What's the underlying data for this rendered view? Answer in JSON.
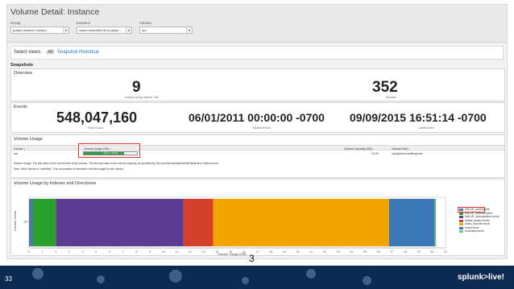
{
  "header": {
    "title": "Volume Detail: Instance",
    "group_label": "Group",
    "group_value": "potato (Indexer Cluster)",
    "instance_label": "Instance",
    "instance_value": "ssdev-centos65-06.sv.splun...",
    "volume_label": "Volume",
    "volume_value": "opt"
  },
  "views": {
    "label": "Select views:",
    "options": [
      "All",
      "Snapshot",
      "Historical"
    ]
  },
  "snapshots_heading": "Snapshots",
  "overview": {
    "title": "Overview",
    "indexes_value": "9",
    "indexes_caption": "Indexes using Volume \"opt\"",
    "buckets_value": "352",
    "buckets_caption": "Buckets"
  },
  "events": {
    "title": "Events",
    "count": "548,047,160",
    "count_caption": "Event Count",
    "earliest": "06/01/2011 00:00:00 -0700",
    "earliest_caption": "Earliest Event",
    "latest": "09/09/2015 16:51:14 -0700",
    "latest_caption": "Latest Event"
  },
  "volume_usage": {
    "title": "Volume Usage",
    "columns": [
      "Volume ↕",
      "Volume Usage (GB) ↕",
      "Volume Capacity (GB) ↕",
      "Volume Path ↕"
    ],
    "row": {
      "volume": "opt",
      "usage_text": "30.21 / 40.00",
      "usage_fraction": 0.755,
      "capacity": "40.00",
      "path": "/opt/splunk/var/lib/splunk"
    },
    "note1": "Volume Usage: The first value is the current size of the volume. The second value is the volume capacity, as specified by the maxVolumeDataSizeMB attribute in indexes.conf.",
    "note2": "Note: If the volume is \"unlimited\", it is not possible to determine the disk usage for the volume."
  },
  "usage_by_index": {
    "title": "Volume Usage by Indexes and Directories"
  },
  "chart_data": {
    "type": "bar",
    "orientation": "horizontal-stacked",
    "title": "",
    "xlabel": "Volume Usage (GB)",
    "ylabel": "Volume Name",
    "xlim": [
      0,
      31
    ],
    "xticks": [
      0,
      1,
      2,
      3,
      4,
      5,
      6,
      7,
      8,
      9,
      10,
      11,
      12,
      13,
      14,
      15,
      16,
      17,
      18,
      19,
      20,
      21,
      22,
      23,
      24,
      25,
      26,
      27,
      28,
      29,
      30,
      31
    ],
    "categories": [
      "opt"
    ],
    "series": [
      {
        "name": "VALUE_audit:home",
        "values": [
          0.3
        ],
        "color": "#4e79a7"
      },
      {
        "name": "VALUE_internal:home",
        "values": [
          1.7
        ],
        "color": "#2ca02c"
      },
      {
        "name": "VALUE_introspection:home",
        "values": [
          9.5
        ],
        "color": "#5c3c92"
      },
      {
        "name": "dbaas_snaps:home",
        "values": [
          2.2
        ],
        "color": "#d43f2a"
      },
      {
        "name": "sales_imports:home",
        "values": [
          13.1
        ],
        "color": "#f0a500"
      },
      {
        "name": "main:home",
        "values": [
          3.4
        ],
        "color": "#3a78b8"
      },
      {
        "name": "summary:home",
        "values": [
          0.1
        ],
        "color": "#7fbf7f"
      }
    ],
    "grid": false,
    "legend": "right"
  },
  "footer": {
    "page_left": "33",
    "page_center": "3",
    "brand": "splunk>live!"
  },
  "colors": {
    "accent_link": "#1e73be",
    "usage_green": "#2e9e3f",
    "footer_bg": "#0c2a52"
  }
}
